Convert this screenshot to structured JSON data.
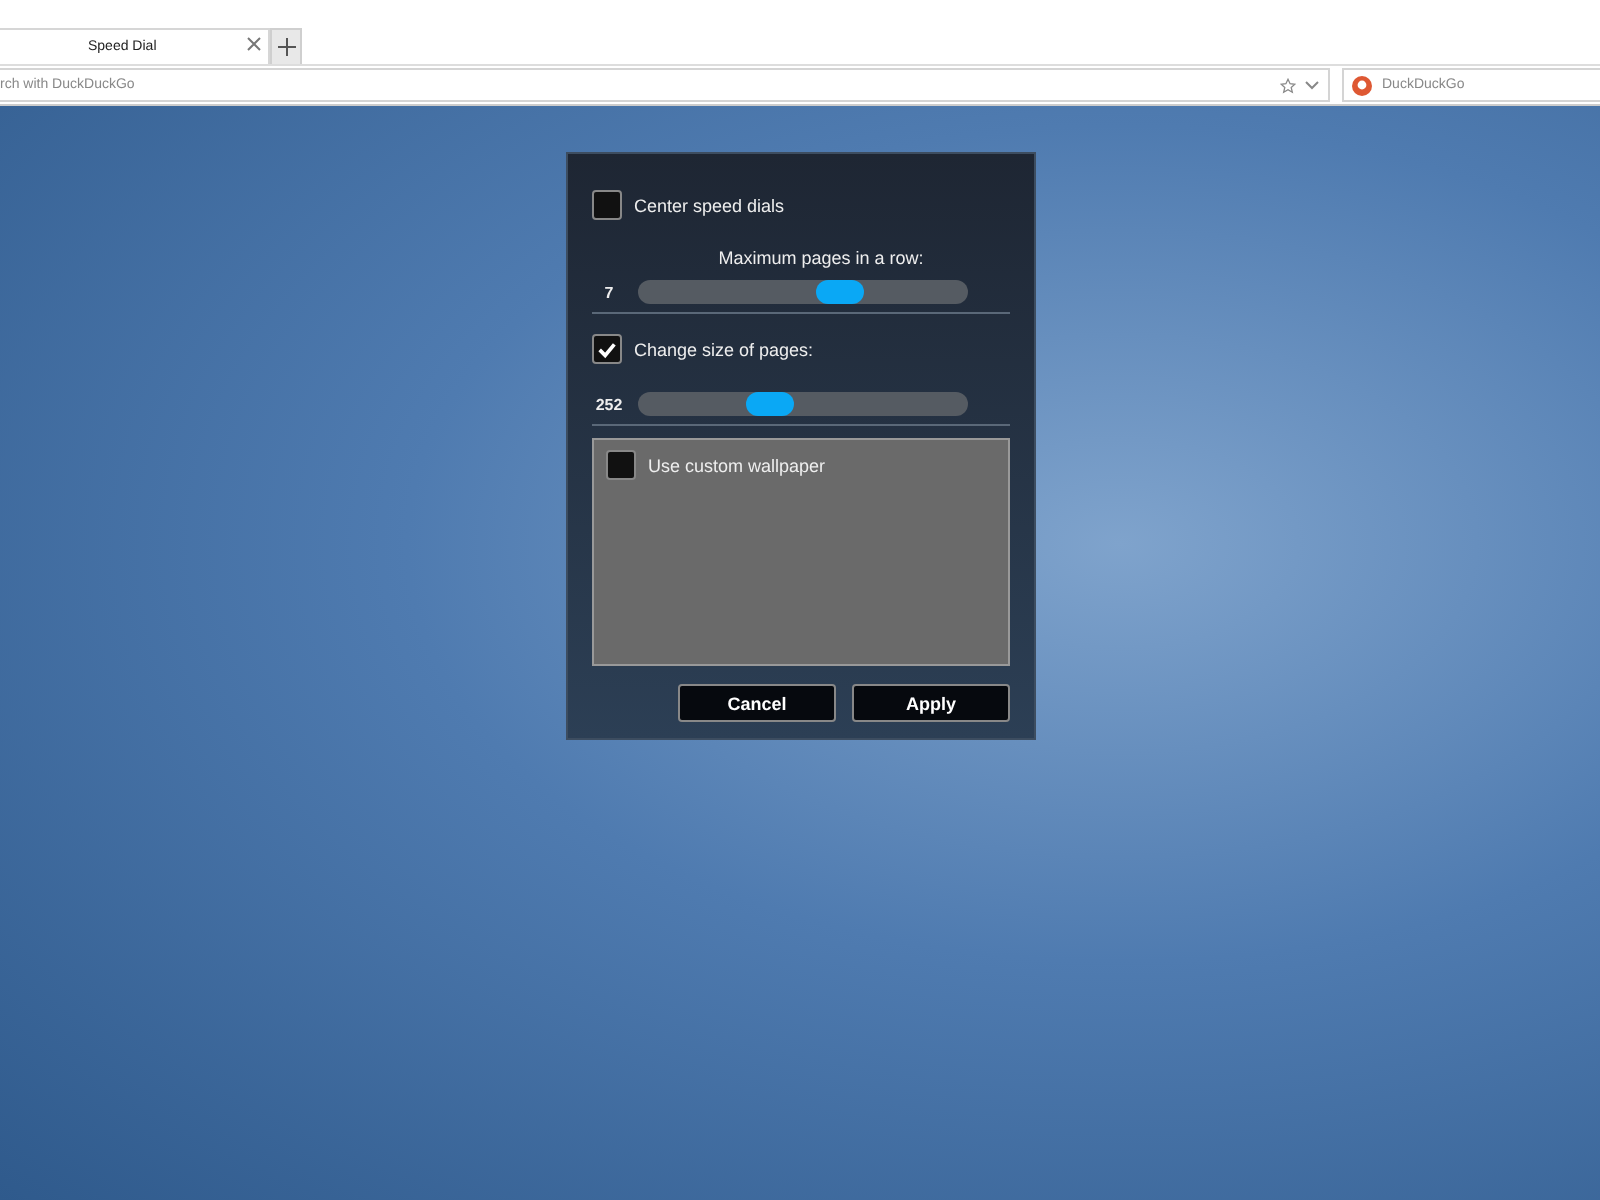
{
  "browser": {
    "tab": {
      "title": "Speed Dial"
    },
    "address_bar": {
      "placeholder": "rch with DuckDuckGo"
    },
    "search_box": {
      "placeholder": "DuckDuckGo"
    }
  },
  "dialog": {
    "center_speed_dials": {
      "label": "Center speed dials",
      "checked": false
    },
    "pages_in_row": {
      "label": "Maximum pages in a row:",
      "reading": "7",
      "level": 0.63
    },
    "change_size": {
      "label": "Change size of pages:",
      "checked": true
    },
    "page_size": {
      "reading": "252",
      "level": 0.38
    },
    "custom_wallpaper": {
      "label": "Use custom wallpaper",
      "checked": false
    },
    "buttons": [
      "Cancel",
      "Apply"
    ]
  }
}
